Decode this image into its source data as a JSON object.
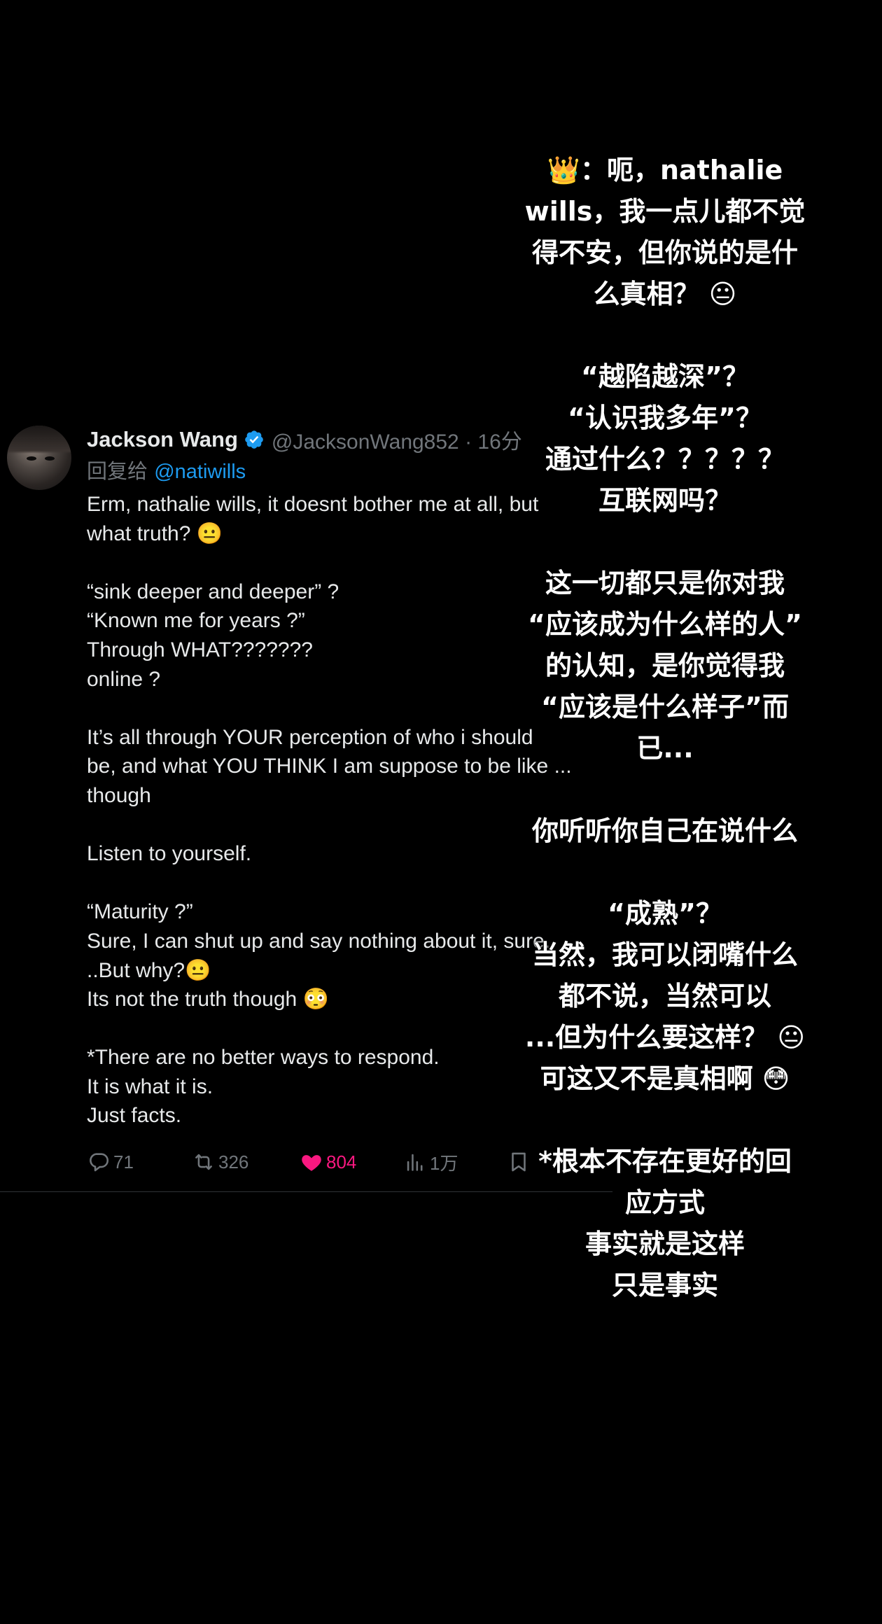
{
  "tweet": {
    "display_name": "Jackson Wang",
    "handle_time": "@JacksonWang852 · 16分",
    "reply_prefix": "回复给 ",
    "reply_handle": "@natiwills",
    "body_lines": [
      "Erm, nathalie wills, it doesnt bother me at all, but",
      "what truth? 😐",
      "",
      "“sink deeper and deeper” ?",
      "“Known me for years ?”",
      "Through WHAT???????",
      "online  ?",
      "",
      "It’s all through YOUR perception of who i should",
      "be, and what YOU THINK I am suppose to be like ...",
      "though",
      "",
      "Listen to yourself.",
      "",
      "“Maturity ?”",
      "Sure, I can shut up and say nothing about it, sure.",
      "..But why?😐",
      "Its not the truth though 😳",
      "",
      "*There are no better ways to respond.",
      "It is what it is.",
      "Just facts."
    ],
    "actions": {
      "replies": "71",
      "reposts": "326",
      "likes": "804",
      "views": "1万"
    },
    "colors": {
      "accent": "#1d9bf0",
      "like": "#f91880",
      "muted": "#71767b"
    }
  },
  "overlay": {
    "lines": [
      "👑：呃，nathalie",
      "wills，我一点儿都不觉",
      "得不安，但你说的是什",
      "么真相？ 😐",
      "",
      "“越陷越深”？",
      "“认识我多年”？",
      "通过什么？？？？？",
      "互联网吗？",
      "",
      "这一切都只是你对我",
      "“应该成为什么样的人”",
      "的认知，是你觉得我",
      "“应该是什么样子”而",
      "已...",
      "",
      "你听听你自己在说什么",
      "",
      "“成熟”？",
      "当然，我可以闭嘴什么",
      "都不说，当然可以",
      "...但为什么要这样？ 😐",
      "可这又不是真相啊 😳",
      "",
      "*根本不存在更好的回",
      "应方式",
      "事实就是这样",
      "只是事实"
    ]
  }
}
